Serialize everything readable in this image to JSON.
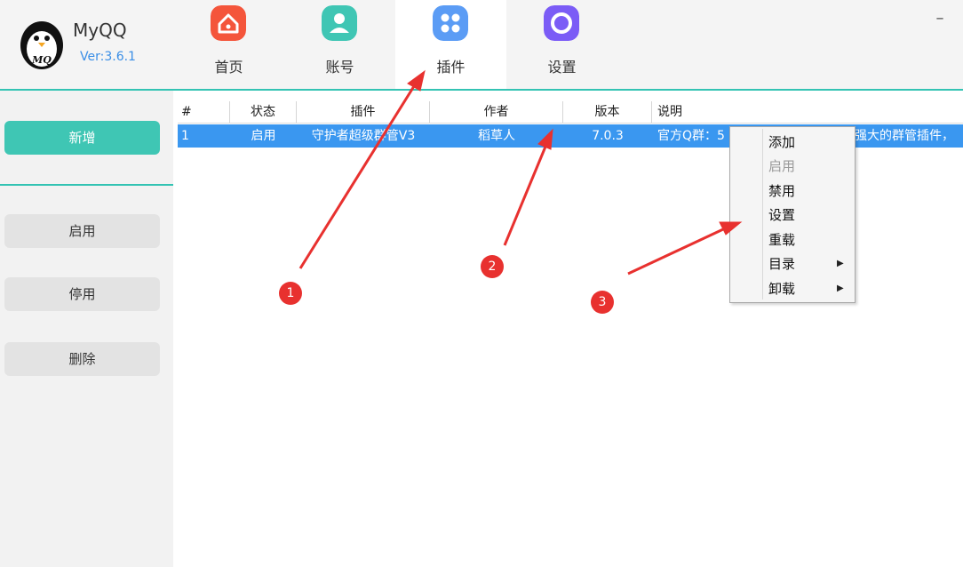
{
  "app": {
    "name": "MyQQ",
    "version": "Ver:3.6.1"
  },
  "nav": [
    {
      "label": "首页",
      "icon": "home-icon",
      "color": "#f4553b"
    },
    {
      "label": "账号",
      "icon": "user-icon",
      "color": "#3fc6b4"
    },
    {
      "label": "插件",
      "icon": "grid-icon",
      "color": "#5b9cf5"
    },
    {
      "label": "设置",
      "icon": "gear-icon",
      "color": "#7b5cf6"
    }
  ],
  "active_tab": "插件",
  "window": {
    "minimize": "–"
  },
  "sidebar": {
    "add": "新增",
    "enable": "启用",
    "disable": "停用",
    "delete": "删除"
  },
  "table": {
    "headers": [
      "#",
      "状态",
      "插件",
      "作者",
      "版本",
      "说明"
    ],
    "rows": [
      {
        "index": "1",
        "status": "启用",
        "plugin": "守护者超级群管V3",
        "author": "稻草人",
        "version": "7.0.3",
        "desc_start": "官方Q群：5",
        "desc_end": "强大的群管插件，"
      }
    ]
  },
  "context_menu": [
    {
      "label": "添加",
      "enabled": true
    },
    {
      "label": "启用",
      "enabled": false
    },
    {
      "label": "禁用",
      "enabled": true
    },
    {
      "label": "设置",
      "enabled": true
    },
    {
      "label": "重载",
      "enabled": true
    },
    {
      "label": "目录",
      "enabled": true,
      "submenu": true
    },
    {
      "label": "卸载",
      "enabled": true,
      "submenu": true
    }
  ],
  "annotations": [
    "1",
    "2",
    "3"
  ],
  "colors": {
    "accent": "#33c3b3",
    "selection": "#3a97f0",
    "annotation": "#e8312f"
  }
}
